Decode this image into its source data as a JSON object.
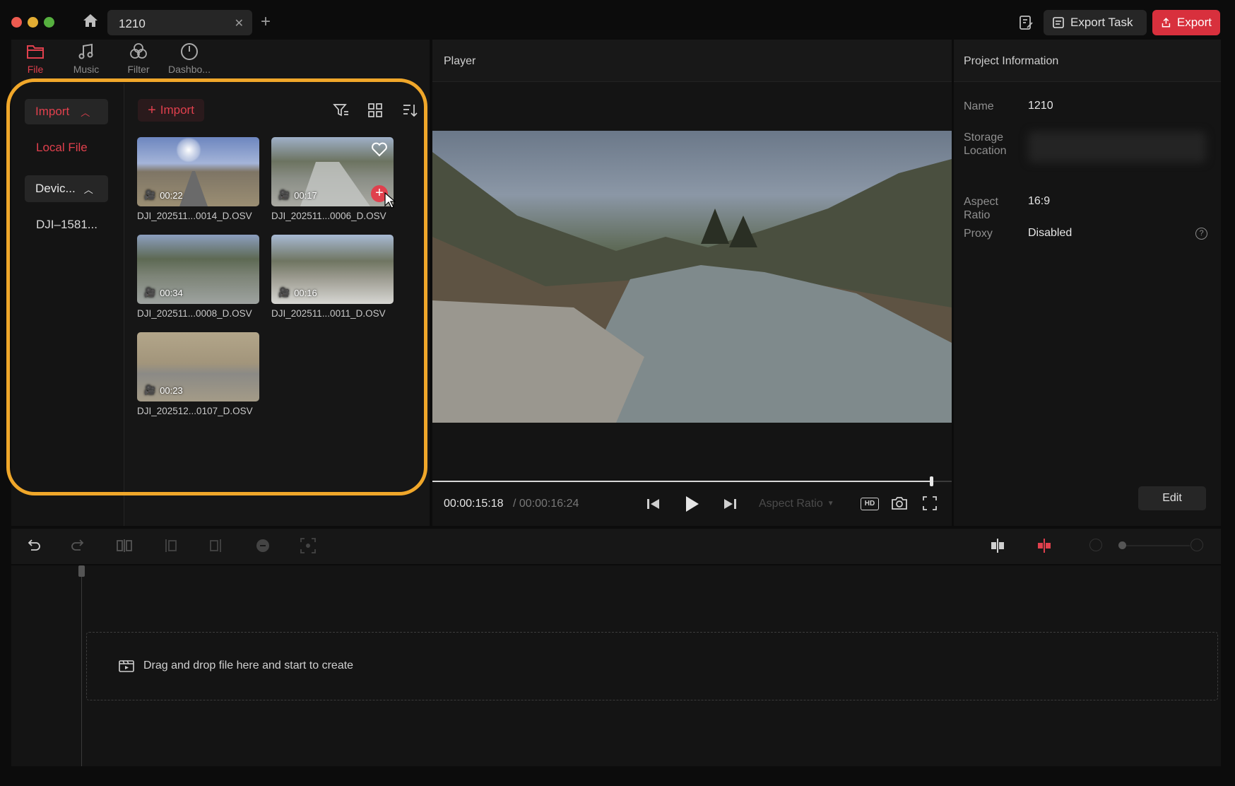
{
  "window": {
    "tab_title": "1210",
    "export_task_label": "Export Task",
    "export_label": "Export"
  },
  "media_tabs": [
    {
      "label": "File",
      "icon": "folder-icon",
      "active": true
    },
    {
      "label": "Music",
      "icon": "music-note-icon",
      "active": false
    },
    {
      "label": "Filter",
      "icon": "filter-circles-icon",
      "active": false
    },
    {
      "label": "Dashbo...",
      "icon": "gauge-icon",
      "active": false
    }
  ],
  "sidebar": {
    "import_label": "Import",
    "local_file_label": "Local File",
    "device_label": "Devic...",
    "device_item": "DJI–1581..."
  },
  "library": {
    "import_button": "Import",
    "items": [
      {
        "duration": "00:22",
        "name": "DJI_202511...0014_D.OSV",
        "favorite": false,
        "hover": false
      },
      {
        "duration": "00:17",
        "name": "DJI_202511...0006_D.OSV",
        "favorite": true,
        "hover": true
      },
      {
        "duration": "00:34",
        "name": "DJI_202511...0008_D.OSV",
        "favorite": false,
        "hover": false
      },
      {
        "duration": "00:16",
        "name": "DJI_202511...0011_D.OSV",
        "favorite": false,
        "hover": false
      },
      {
        "duration": "00:23",
        "name": "DJI_202512...0107_D.OSV",
        "favorite": false,
        "hover": false
      }
    ]
  },
  "player": {
    "title": "Player",
    "current_time": "00:00:15:18",
    "total_time": "/ 00:00:16:24",
    "aspect_ratio_label": "Aspect Ratio",
    "progress": 0.96
  },
  "project_info": {
    "title": "Project Information",
    "name_label": "Name",
    "name_value": "1210",
    "storage_label_1": "Storage",
    "storage_label_2": "Location",
    "aspect_label_1": "Aspect",
    "aspect_label_2": "Ratio",
    "aspect_value": "16:9",
    "proxy_label": "Proxy",
    "proxy_value": "Disabled",
    "edit_label": "Edit"
  },
  "timeline": {
    "drop_hint": "Drag and drop file here and start to create"
  },
  "colors": {
    "accent_red": "#e0404d",
    "highlight_orange": "#f0a72a",
    "export_bg": "#d8303d"
  }
}
